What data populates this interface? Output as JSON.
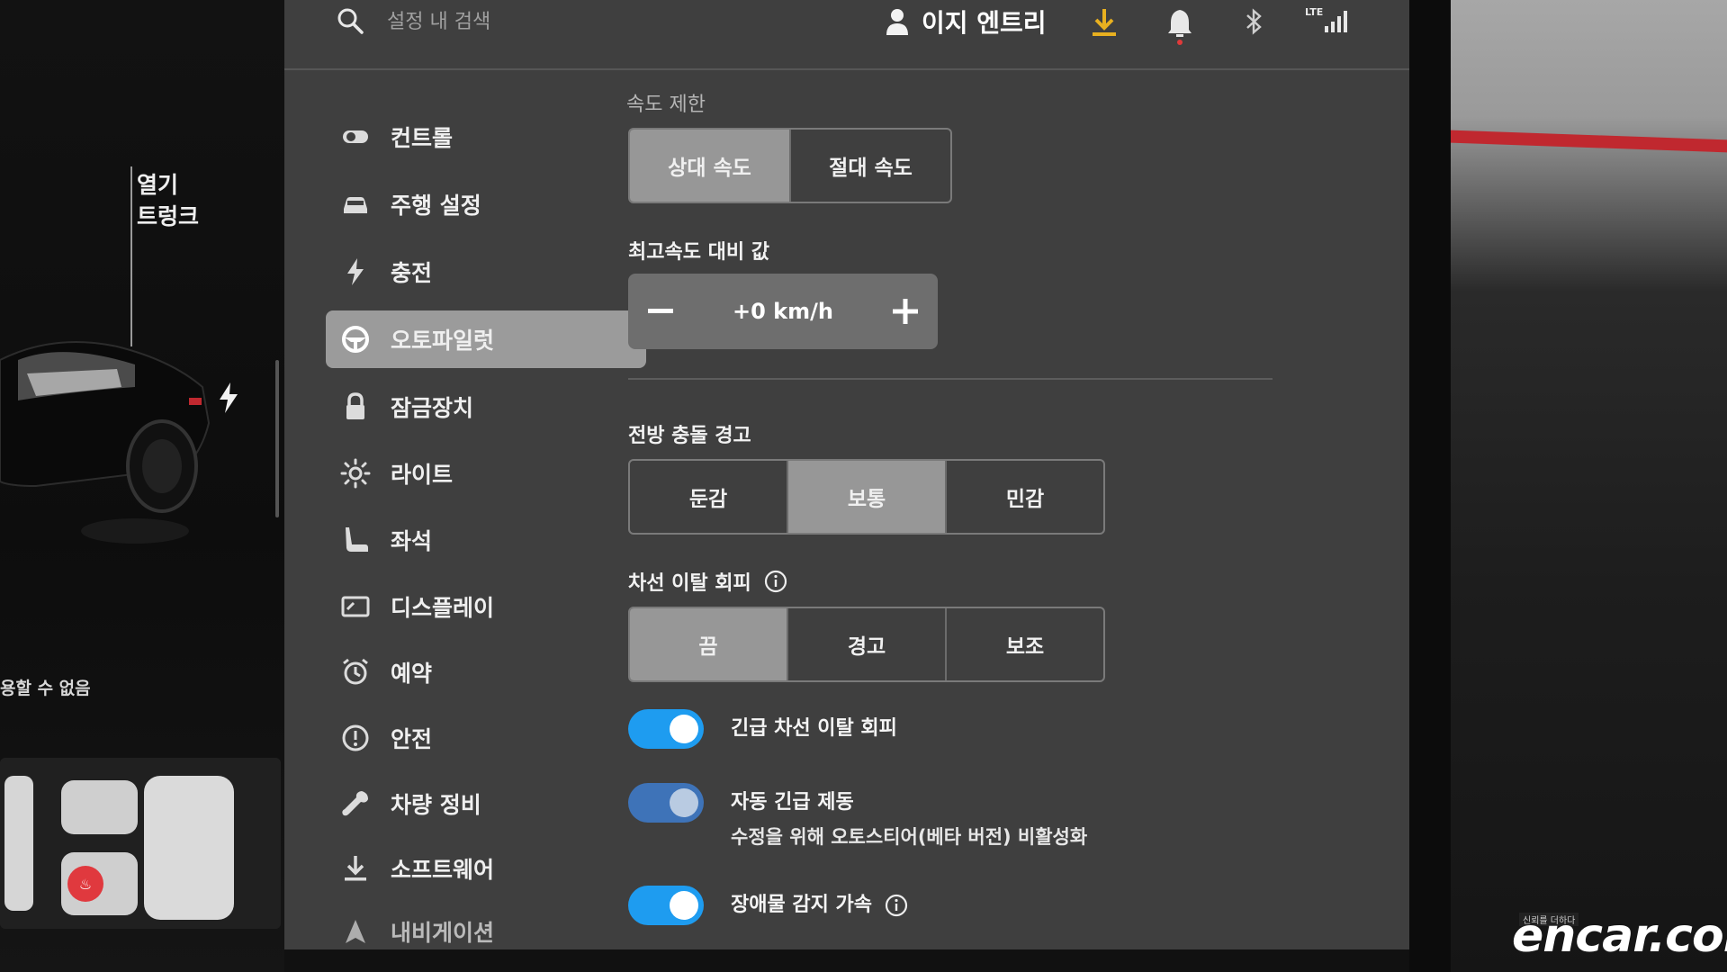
{
  "car_panel": {
    "trunk_label_line1": "열기",
    "trunk_label_line2": "트렁크",
    "unavailable_text": "용할 수 없음"
  },
  "topbar": {
    "search_placeholder": "설정 내 검색",
    "profile_name": "이지 엔트리",
    "signal_label": "LTE",
    "download_icon": "download-icon",
    "notification_icon": "bell-icon",
    "bluetooth_icon": "bluetooth-icon",
    "accent_color": "#e8b020"
  },
  "sidebar": {
    "items": [
      {
        "label": "컨트롤",
        "icon": "toggle-icon"
      },
      {
        "label": "주행 설정",
        "icon": "car-icon"
      },
      {
        "label": "충전",
        "icon": "bolt-icon"
      },
      {
        "label": "오토파일럿",
        "icon": "steering-wheel-icon",
        "active": true
      },
      {
        "label": "잠금장치",
        "icon": "lock-icon"
      },
      {
        "label": "라이트",
        "icon": "sun-icon"
      },
      {
        "label": "좌석",
        "icon": "seat-icon"
      },
      {
        "label": "디스플레이",
        "icon": "display-icon"
      },
      {
        "label": "예약",
        "icon": "alarm-clock-icon"
      },
      {
        "label": "안전",
        "icon": "alert-circle-icon"
      },
      {
        "label": "차량 정비",
        "icon": "wrench-icon"
      },
      {
        "label": "소프트웨어",
        "icon": "download-icon"
      },
      {
        "label": "내비게이션",
        "icon": "navigation-icon"
      }
    ]
  },
  "speed_limit": {
    "title": "속도 제한",
    "options": [
      "상대 속도",
      "절대 속도"
    ],
    "selected": "상대 속도"
  },
  "speed_offset": {
    "title": "최고속도 대비 값",
    "value": "+0 km/h"
  },
  "forward_collision": {
    "title": "전방 충돌 경고",
    "options": [
      "둔감",
      "보통",
      "민감"
    ],
    "selected": "보통"
  },
  "lane_departure": {
    "title": "차선 이탈 회피",
    "options": [
      "끔",
      "경고",
      "보조"
    ],
    "selected": "끔"
  },
  "toggles": {
    "emergency_lane": {
      "label": "긴급 차선 이탈 회피",
      "on": true
    },
    "auto_emergency_braking": {
      "label": "자동 긴급 제동",
      "sub": "수정을 위해 오토스티어(베타 버전) 비활성화",
      "on": true
    },
    "obstacle_accel": {
      "label": "장애물 감지 가속",
      "on": true
    }
  },
  "toggle_color": "#1e9cf0",
  "watermark": {
    "brand": "encar.com",
    "tag": "신뢰를 더하다"
  }
}
